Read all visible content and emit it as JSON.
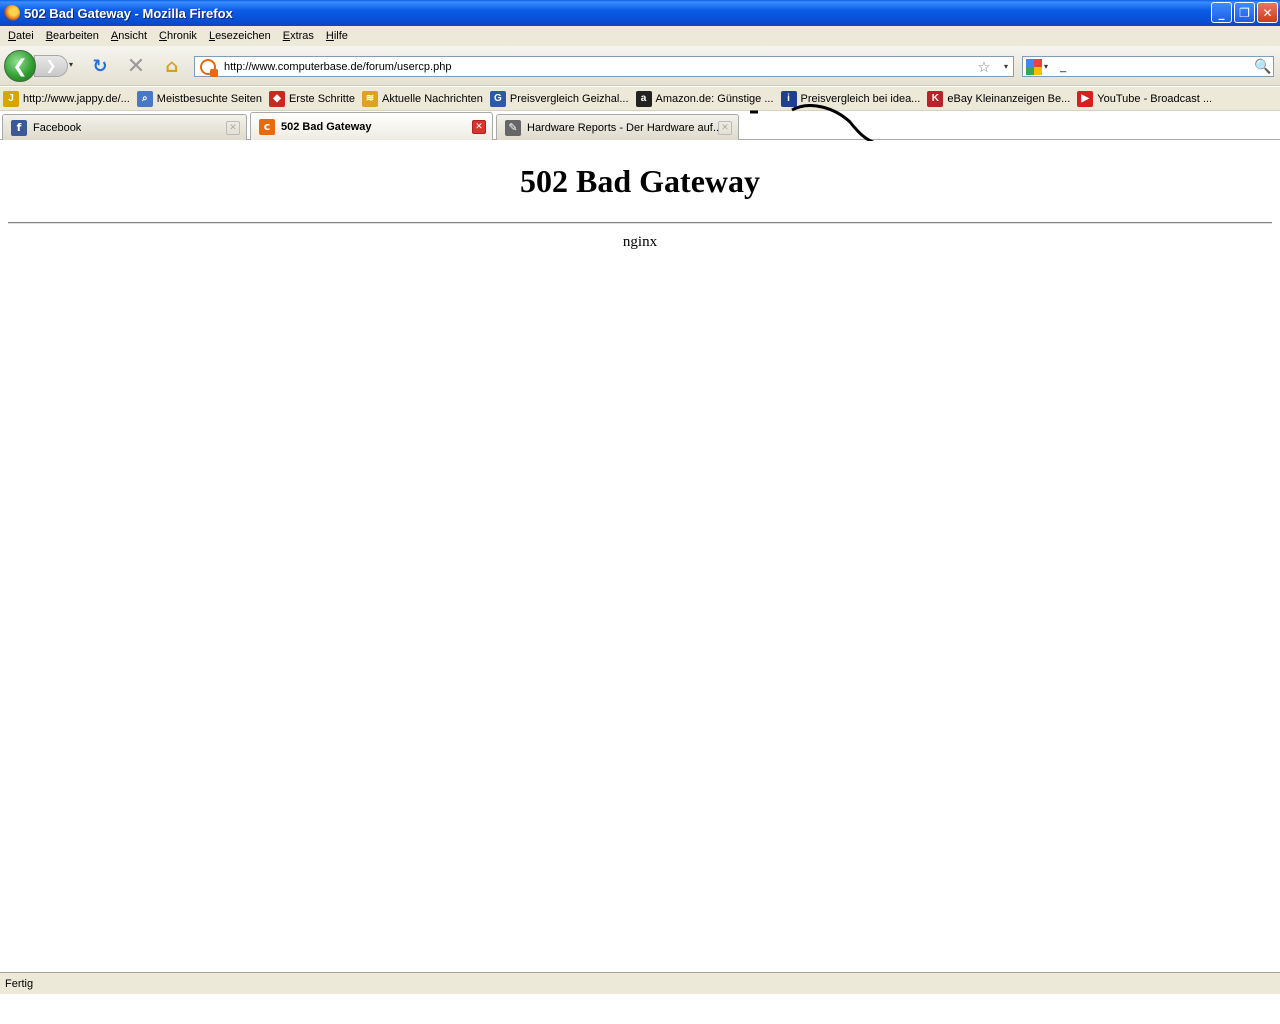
{
  "window": {
    "title": "502 Bad Gateway - Mozilla Firefox",
    "minimize": "_",
    "restore": "❐",
    "close": "✕"
  },
  "menu": [
    "Datei",
    "Bearbeiten",
    "Ansicht",
    "Chronik",
    "Lesezeichen",
    "Extras",
    "Hilfe"
  ],
  "nav": {
    "url": "http://www.computerbase.de/forum/usercp.php",
    "search_value": "_",
    "back_glyph": "❮",
    "forward_glyph": "❯",
    "reload_glyph": "↻",
    "stop_glyph": "✕",
    "home_glyph": "⌂",
    "star_glyph": "☆",
    "dropdown_glyph": "▾",
    "magnifier_glyph": "🔍"
  },
  "bookmarks": [
    {
      "label": "http://www.jappy.de/...",
      "icon": "jappy-icon",
      "color": "#d9a300",
      "glyph": "J"
    },
    {
      "label": "Meistbesuchte Seiten",
      "icon": "folder-search-icon",
      "color": "#4a78c8",
      "glyph": "⌕"
    },
    {
      "label": "Erste Schritte",
      "icon": "firefox-icon",
      "color": "#c8281e",
      "glyph": "◆"
    },
    {
      "label": "Aktuelle Nachrichten",
      "icon": "rss-folder-icon",
      "color": "#e0a020",
      "glyph": "≋"
    },
    {
      "label": "Preisvergleich Geizhal...",
      "icon": "geizhals-icon",
      "color": "#2b5aa8",
      "glyph": "G"
    },
    {
      "label": "Amazon.de: Günstige ...",
      "icon": "amazon-icon",
      "color": "#222222",
      "glyph": "a"
    },
    {
      "label": "Preisvergleich bei idea...",
      "icon": "idealo-icon",
      "color": "#1f3f8f",
      "glyph": "i"
    },
    {
      "label": "eBay Kleinanzeigen Be...",
      "icon": "kleinanzeigen-icon",
      "color": "#b8232a",
      "glyph": "K"
    },
    {
      "label": "YouTube - Broadcast ...",
      "icon": "youtube-icon",
      "color": "#d81e1e",
      "glyph": "▶"
    }
  ],
  "tabs": [
    {
      "label": "Facebook",
      "icon": "facebook-icon",
      "color": "#3b5998",
      "glyph": "f",
      "close": "✕"
    },
    {
      "label": "502 Bad Gateway",
      "icon": "computerbase-icon",
      "color": "#e56a10",
      "glyph": "c",
      "close": "✕"
    },
    {
      "label": "Hardware Reports - Der Hardware auf...",
      "icon": "hardware-reports-icon",
      "color": "#666666",
      "glyph": "✎",
      "close": "✕"
    }
  ],
  "content": {
    "heading": "502 Bad Gateway",
    "server": "nginx"
  },
  "status": {
    "text": "Fertig"
  }
}
